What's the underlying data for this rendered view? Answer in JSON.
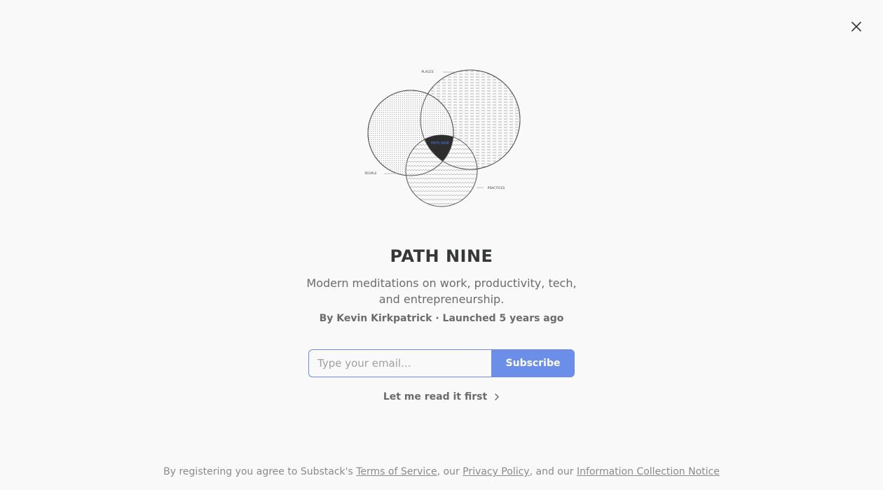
{
  "publication": {
    "title": "PATH NINE",
    "description": "Modern meditations on work, productivity, tech, and entrepreneurship.",
    "byline": "By Kevin Kirkpatrick · Launched 5 years ago"
  },
  "logo": {
    "labels": {
      "places": "PLACES",
      "people": "PEOPLE",
      "practices": "PRACTICES",
      "center": "PATH NINE"
    },
    "accent": "#4a78d8"
  },
  "form": {
    "email_placeholder": "Type your email...",
    "subscribe_label": "Subscribe"
  },
  "read_first_label": "Let me read it first",
  "footer": {
    "prefix": "By registering you agree to Substack's ",
    "terms": "Terms of Service",
    "sep1": ", our ",
    "privacy": "Privacy Policy",
    "sep2": ", and our ",
    "notice": "Information Collection Notice"
  },
  "icons": {
    "close": "close-icon",
    "chevron": "chevron-right-icon"
  },
  "colors": {
    "background": "#f9f9f9",
    "accent": "#6b8ee8",
    "text": "#363737",
    "muted": "#6b6b6b"
  }
}
